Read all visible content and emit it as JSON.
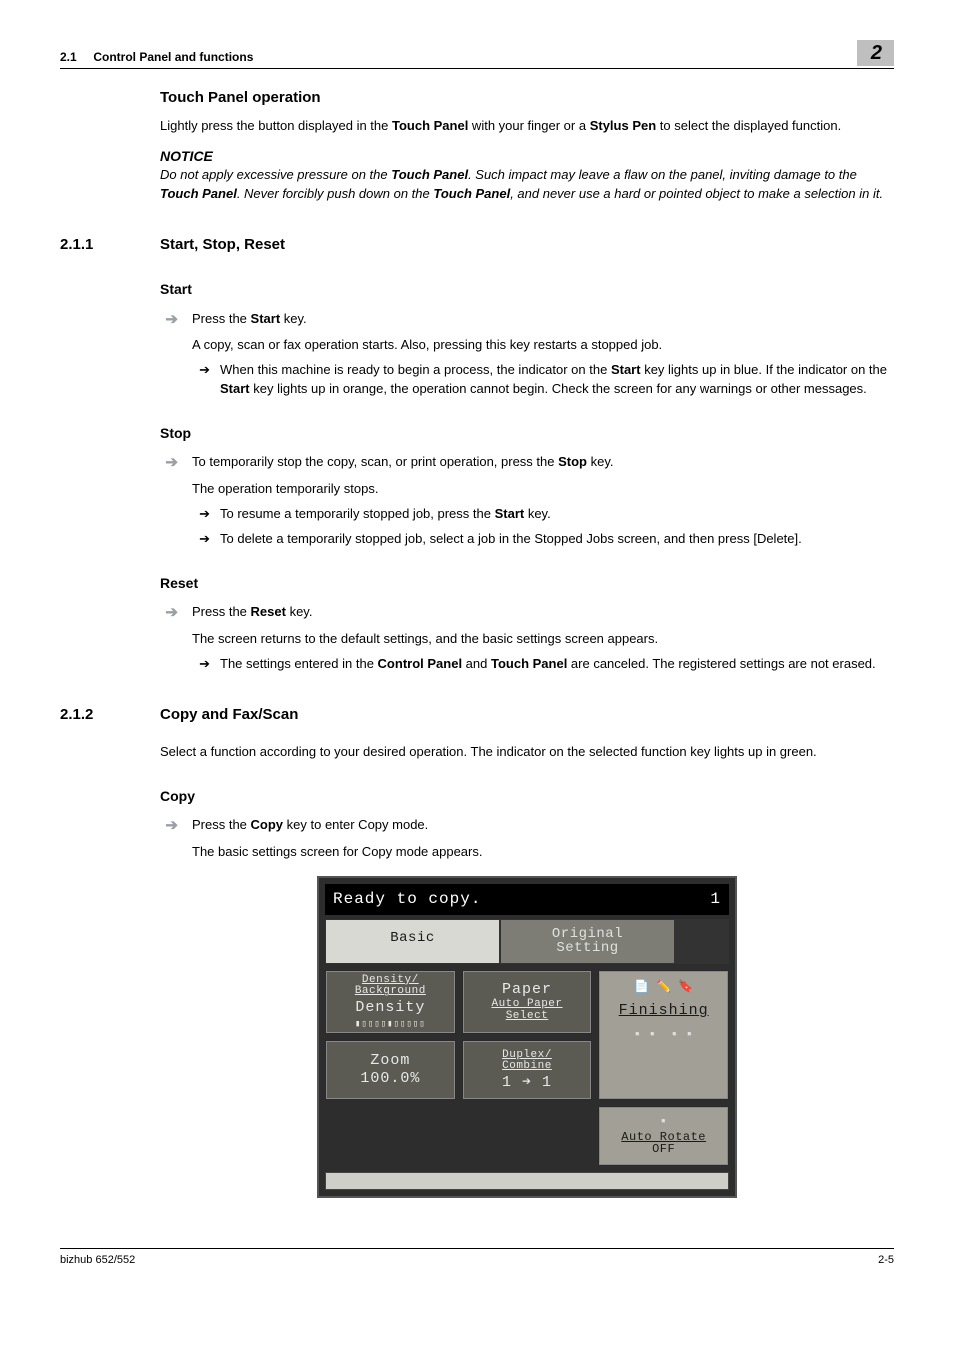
{
  "header": {
    "left_num": "2.1",
    "left_title": "Control Panel and functions",
    "right_num": "2"
  },
  "touch_panel": {
    "heading": "Touch Panel operation",
    "intro_pre": "Lightly press the button displayed in the ",
    "intro_b1": "Touch Panel",
    "intro_mid": " with your finger or a ",
    "intro_b2": "Stylus Pen",
    "intro_post": " to select the displayed function.",
    "notice_label": "NOTICE",
    "notice_pre": "Do not apply excessive pressure on the ",
    "notice_b1": "Touch Panel",
    "notice_mid1": ". Such impact may leave a flaw on the panel, inviting damage to the ",
    "notice_b2": "Touch Panel",
    "notice_mid2": ". Never forcibly push down on the ",
    "notice_b3": "Touch Panel",
    "notice_post": ", and never use a hard or pointed object to make a selection in it."
  },
  "sec211": {
    "num": "2.1.1",
    "title": "Start, Stop, Reset"
  },
  "start": {
    "heading": "Start",
    "press_pre": "Press the ",
    "press_b": "Start",
    "press_post": " key.",
    "result": "A copy, scan or fax operation starts. Also, pressing this key restarts a stopped job.",
    "bullet_pre": "When this machine is ready to begin a process, the indicator on the ",
    "bullet_b1": "Start",
    "bullet_mid1": " key lights up in blue. If the indicator on the ",
    "bullet_b2": "Start",
    "bullet_post": " key lights up in orange, the operation cannot begin. Check the screen for any warnings or other messages."
  },
  "stop": {
    "heading": "Stop",
    "press_pre": "To temporarily stop the copy, scan, or print operation, press the ",
    "press_b": "Stop",
    "press_post": " key.",
    "result": "The operation temporarily stops.",
    "b1_pre": "To resume a temporarily stopped job, press the ",
    "b1_b": "Start",
    "b1_post": " key.",
    "b2": "To delete a temporarily stopped job, select a job in the Stopped Jobs screen, and then press [Delete]."
  },
  "reset": {
    "heading": "Reset",
    "press_pre": "Press the ",
    "press_b": "Reset",
    "press_post": " key.",
    "result": "The screen returns to the default settings, and the basic settings screen appears.",
    "b1_pre": "The settings entered in the ",
    "b1_b1": "Control Panel",
    "b1_mid": " and ",
    "b1_b2": "Touch Panel",
    "b1_post": " are canceled. The registered settings are not erased."
  },
  "sec212": {
    "num": "2.1.2",
    "title": "Copy and Fax/Scan",
    "intro": "Select a function according to your desired operation. The indicator on the selected function key lights up in green."
  },
  "copy": {
    "heading": "Copy",
    "press_pre": "Press the ",
    "press_b": "Copy",
    "press_post": " key to enter Copy mode.",
    "result": "The basic settings screen for Copy mode appears."
  },
  "screen": {
    "top_left": "Ready to copy.",
    "top_right": "1",
    "tab_basic": "Basic",
    "tab_orig1": "Original",
    "tab_orig2": "Setting",
    "density_top1": "Density/",
    "density_top2": "Background",
    "density_main": "Density",
    "density_dots": "▮▯▯▯▯▮▯▯▯▯▯",
    "paper_label": "Paper",
    "paper_sub1": "Auto Paper",
    "paper_sub2": "Select",
    "zoom_label": "Zoom",
    "zoom_value": "100.0%",
    "duplex1": "Duplex/",
    "duplex2": "Combine",
    "duplex_val": "1 ➔ 1",
    "finishing": "Finishing",
    "auto_rotate1": "Auto Rotate",
    "auto_rotate2": "OFF"
  },
  "footer": {
    "left": "bizhub 652/552",
    "right": "2-5"
  }
}
